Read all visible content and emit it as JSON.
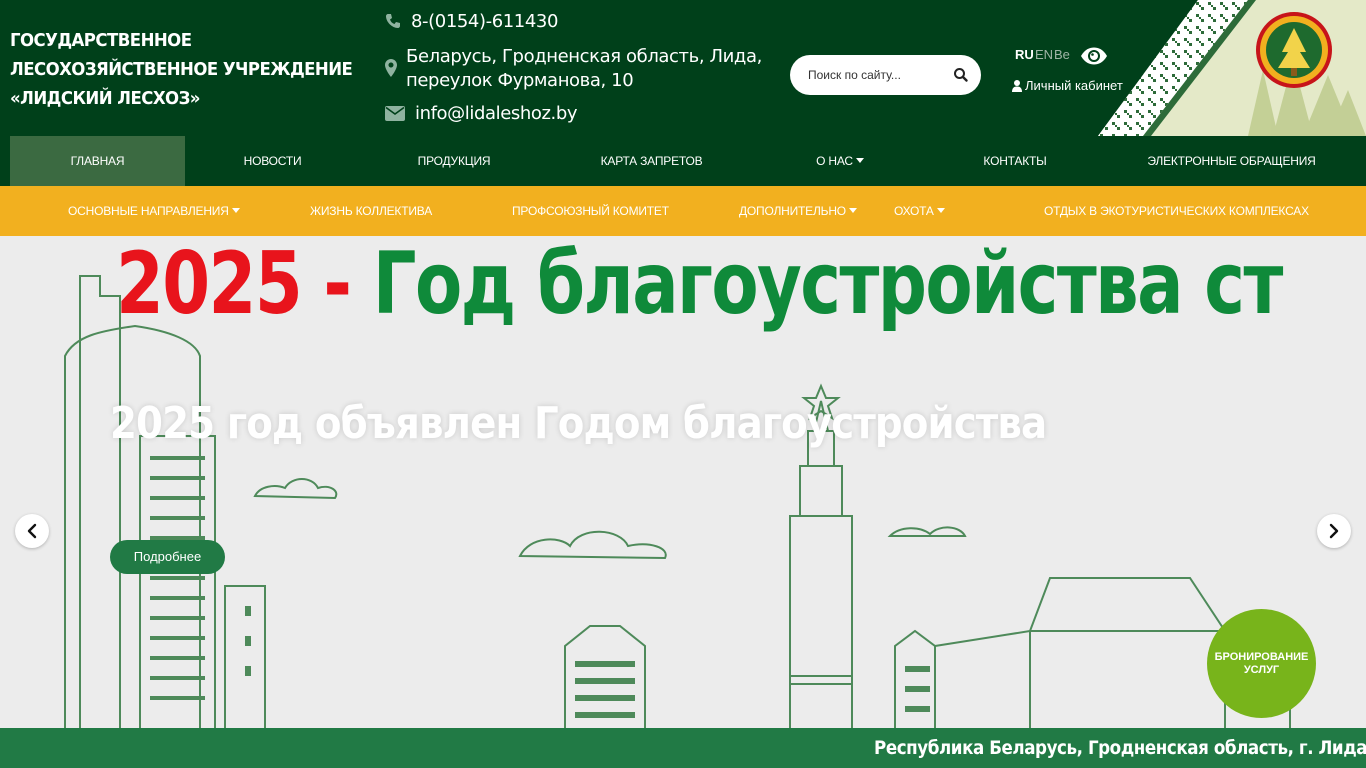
{
  "header": {
    "org_title_lines": [
      "ГОСУДАРСТВЕННОЕ",
      "ЛЕСОХОЗЯЙСТВЕННОЕ УЧРЕЖДЕНИЕ",
      "«ЛИДСКИЙ ЛЕСХОЗ»"
    ],
    "phone": "8-(0154)-611430",
    "address": "Беларусь, Гродненская область, Лида, переулок Фурманова, 10",
    "email": "info@lidaleshoz.by",
    "search_placeholder": "Поиск по сайту...",
    "languages": [
      "RU",
      "EN",
      "Be"
    ],
    "active_language": "RU",
    "cabinet_label": "Личный кабинет",
    "icons": {
      "phone": "phone-icon",
      "address": "map-marker-icon",
      "email": "envelope-icon",
      "search": "search-icon",
      "accessibility": "eye-icon",
      "cabinet": "user-icon"
    }
  },
  "nav_main": [
    {
      "label": "Главная",
      "active": true
    },
    {
      "label": "Новости"
    },
    {
      "label": "Продукция"
    },
    {
      "label": "Карта запретов"
    },
    {
      "label": "О нас",
      "dropdown": true
    },
    {
      "label": "Контакты"
    },
    {
      "label": "Электронные обращения"
    }
  ],
  "nav_secondary": [
    {
      "label": "Основные направления",
      "dropdown": true
    },
    {
      "label": "Жизнь коллектива"
    },
    {
      "label": "Профсоюзный комитет"
    },
    {
      "label": "Дополнительно",
      "dropdown": true
    },
    {
      "label": "Охота",
      "dropdown": true
    },
    {
      "label": "Отдых в экотуристических комплексах"
    }
  ],
  "hero": {
    "banner_year": "2025 -",
    "banner_text": "Год благоустройства ст",
    "caption": "2025 год объявлен Годом благоустройства",
    "button_label": "Подробнее"
  },
  "booking_label": "БРОНИРОВАНИЕ УСЛУГ",
  "ticker_text": "Республика Беларусь, Гродненская область, г. Лида, переу",
  "colors": {
    "header_bg": "#00401a",
    "nav_active": "#3b6a41",
    "nav_secondary_bg": "#f2b01f",
    "accent_green": "#217a45",
    "booking_green": "#78b41b",
    "banner_red": "#e8141c",
    "banner_green": "#0f8a3a"
  }
}
